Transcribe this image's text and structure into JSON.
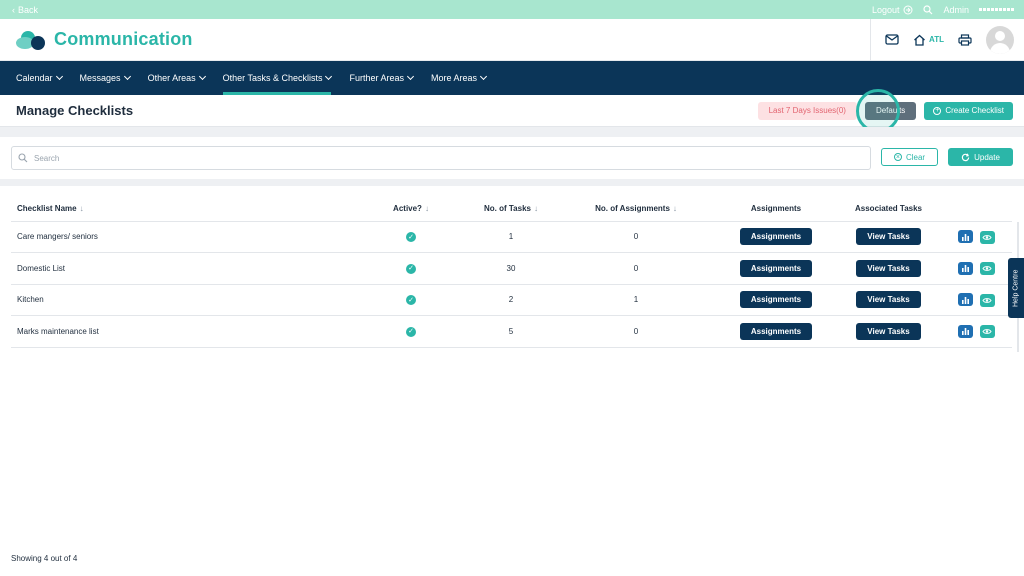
{
  "topbar": {
    "back_label": "Back",
    "logout_label": "Logout",
    "admin_label": "Admin"
  },
  "brand": {
    "title": "Communication"
  },
  "header": {
    "home_label": "ATL"
  },
  "nav": {
    "items": [
      {
        "label": "Calendar"
      },
      {
        "label": "Messages"
      },
      {
        "label": "Other Areas"
      },
      {
        "label": "Other Tasks & Checklists",
        "active": true
      },
      {
        "label": "Further Areas"
      },
      {
        "label": "More Areas"
      }
    ]
  },
  "page": {
    "title": "Manage Checklists",
    "issues_label": "Last 7 Days Issues(0)",
    "defaults_label": "Defaults",
    "create_label": "Create Checklist"
  },
  "search": {
    "placeholder": "Search",
    "clear_label": "Clear",
    "update_label": "Update"
  },
  "table": {
    "headers": {
      "name": "Checklist Name",
      "active": "Active?",
      "tasks": "No. of Tasks",
      "assignments_count": "No. of Assignments",
      "assignments": "Assignments",
      "associated": "Associated Tasks"
    },
    "rows": [
      {
        "name": "Care mangers/ seniors",
        "tasks": "1",
        "assignments": "0",
        "assign_btn": "Assignments",
        "view_btn": "View Tasks"
      },
      {
        "name": "Domestic List",
        "tasks": "30",
        "assignments": "0",
        "assign_btn": "Assignments",
        "view_btn": "View Tasks"
      },
      {
        "name": "Kitchen",
        "tasks": "2",
        "assignments": "1",
        "assign_btn": "Assignments",
        "view_btn": "View Tasks"
      },
      {
        "name": "Marks maintenance list",
        "tasks": "5",
        "assignments": "0",
        "assign_btn": "Assignments",
        "view_btn": "View Tasks"
      }
    ]
  },
  "help_label": "Help Centre",
  "footer": {
    "count_text": "Showing 4 out of 4"
  },
  "colors": {
    "accent": "#2bb6a8",
    "navy": "#0b3558",
    "topbar": "#a8e6cf",
    "danger": "#e26470"
  }
}
